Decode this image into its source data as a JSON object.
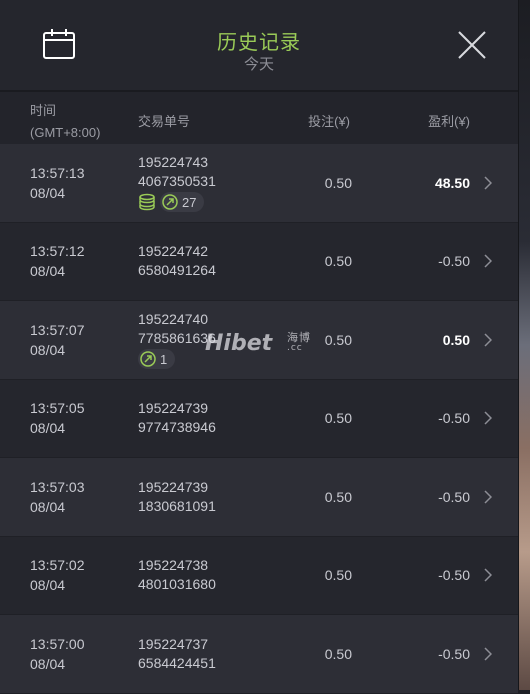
{
  "header": {
    "title": "历史记录",
    "subtitle": "今天"
  },
  "columns": {
    "time_line1": "时间",
    "time_line2": "(GMT+8:00)",
    "order_id": "交易单号",
    "bet": "投注(¥)",
    "profit": "盈利(¥)"
  },
  "rows": [
    {
      "time": "13:57:13",
      "date": "08/04",
      "id1": "195224743",
      "id2": "4067350531",
      "bet": "0.50",
      "profit": "48.50",
      "win": true,
      "coin_badge": true,
      "link_count": "27"
    },
    {
      "time": "13:57:12",
      "date": "08/04",
      "id1": "195224742",
      "id2": "6580491264",
      "bet": "0.50",
      "profit": "-0.50",
      "win": false
    },
    {
      "time": "13:57:07",
      "date": "08/04",
      "id1": "195224740",
      "id2": "7785861636",
      "bet": "0.50",
      "profit": "0.50",
      "win": true,
      "coin_badge": false,
      "link_count": "1"
    },
    {
      "time": "13:57:05",
      "date": "08/04",
      "id1": "195224739",
      "id2": "9774738946",
      "bet": "0.50",
      "profit": "-0.50",
      "win": false
    },
    {
      "time": "13:57:03",
      "date": "08/04",
      "id1": "195224739",
      "id2": "1830681091",
      "bet": "0.50",
      "profit": "-0.50",
      "win": false
    },
    {
      "time": "13:57:02",
      "date": "08/04",
      "id1": "195224738",
      "id2": "4801031680",
      "bet": "0.50",
      "profit": "-0.50",
      "win": false
    },
    {
      "time": "13:57:00",
      "date": "08/04",
      "id1": "195224737",
      "id2": "6584424451",
      "bet": "0.50",
      "profit": "-0.50",
      "win": false
    }
  ],
  "watermark": {
    "text": "Hibet",
    "cn": "海博",
    "domain": ".cc"
  },
  "colors": {
    "accent_title": "#9acb57",
    "panel_bg": "#23242b",
    "row_alt": "#2d2e36"
  },
  "icons": {
    "calendar": "calendar-icon",
    "close": "close-icon",
    "chevron": "chevron-right-icon",
    "coins": "coin-stack-icon",
    "link": "link-icon"
  }
}
